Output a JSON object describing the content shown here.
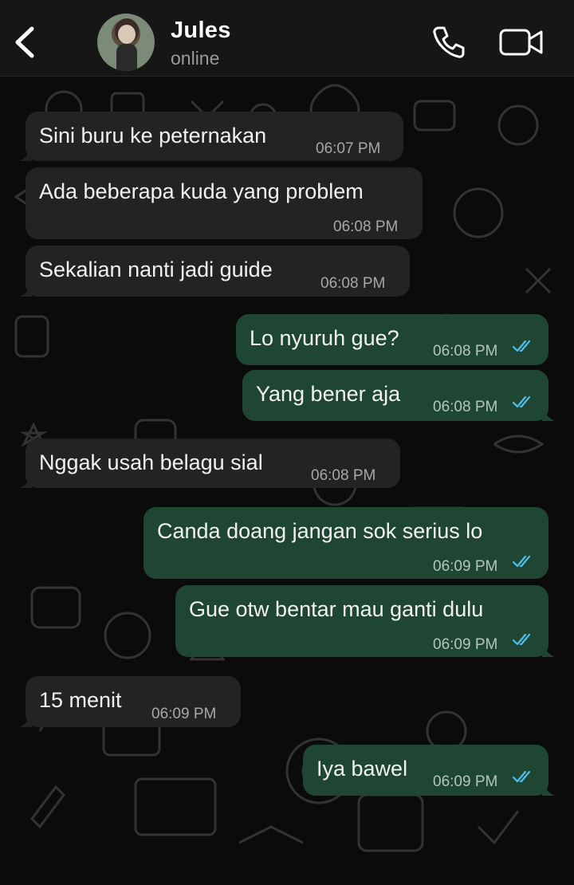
{
  "header": {
    "contact_name": "Jules",
    "status": "online"
  },
  "icons": {
    "back": "chevron-left-icon",
    "call": "phone-icon",
    "video": "video-camera-icon",
    "read": "double-check-icon"
  },
  "colors": {
    "incoming_bubble": "#232323",
    "outgoing_bubble": "#1e4632",
    "read_ticks": "#53bdeb",
    "background": "#0b0b0b"
  },
  "messages": [
    {
      "direction": "incoming",
      "text": "Sini buru ke peternakan",
      "time": "06:07 PM"
    },
    {
      "direction": "incoming",
      "text": "Ada beberapa kuda yang problem",
      "time": "06:08 PM"
    },
    {
      "direction": "incoming",
      "text": "Sekalian nanti jadi guide",
      "time": "06:08 PM"
    },
    {
      "direction": "outgoing",
      "text": "Lo nyuruh gue?",
      "time": "06:08 PM",
      "status": "read"
    },
    {
      "direction": "outgoing",
      "text": "Yang bener aja",
      "time": "06:08 PM",
      "status": "read"
    },
    {
      "direction": "incoming",
      "text": "Nggak usah belagu sial",
      "time": "06:08 PM"
    },
    {
      "direction": "outgoing",
      "text": "Canda doang jangan sok serius lo",
      "time": "06:09 PM",
      "status": "read"
    },
    {
      "direction": "outgoing",
      "text": "Gue otw bentar mau ganti dulu",
      "time": "06:09 PM",
      "status": "read"
    },
    {
      "direction": "incoming",
      "text": "15 menit",
      "time": "06:09 PM"
    },
    {
      "direction": "outgoing",
      "text": "Iya bawel",
      "time": "06:09 PM",
      "status": "read"
    }
  ]
}
